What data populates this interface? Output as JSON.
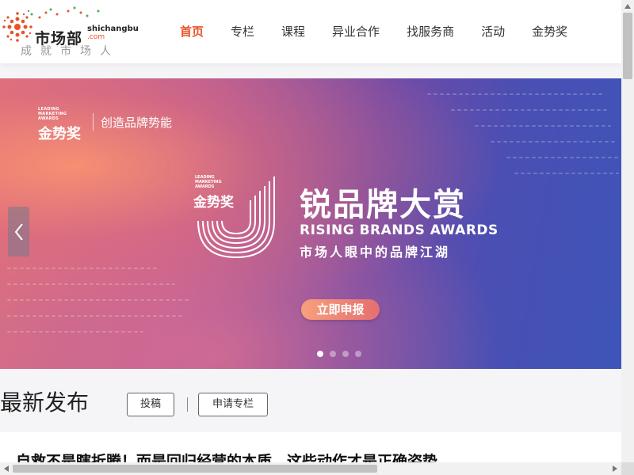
{
  "logo": {
    "name": "市场部",
    "pinyin": "shichangbu",
    "com": ".com",
    "slogan": "成就市场人"
  },
  "nav": {
    "items": [
      {
        "label": "首页",
        "active": true
      },
      {
        "label": "专栏"
      },
      {
        "label": "课程"
      },
      {
        "label": "异业合作"
      },
      {
        "label": "找服务商"
      },
      {
        "label": "活动"
      },
      {
        "label": "金势奖"
      }
    ]
  },
  "banner": {
    "brand_en": "LEADING MARKETING AWARDS",
    "brand_cn": "金势奖",
    "brand_tag": "创造品牌势能",
    "emblem_en": "LEADING MARKETING AWARDS",
    "emblem_cn": "金势奖",
    "title": "锐品牌大赏",
    "title_en": "RISING BRANDS AWARDS",
    "subtitle": "市场人眼中的品牌江湖",
    "cta": "立即申报",
    "slide_count": 4,
    "active_slide": 1
  },
  "latest": {
    "title": "最新发布",
    "submit_label": "投稿",
    "apply_column_label": "申请专栏"
  },
  "article": {
    "title": "自救不是瞎折腾！而是回归经营的本质，这些动作才是正确姿势"
  },
  "colors": {
    "accent": "#e8532b"
  }
}
